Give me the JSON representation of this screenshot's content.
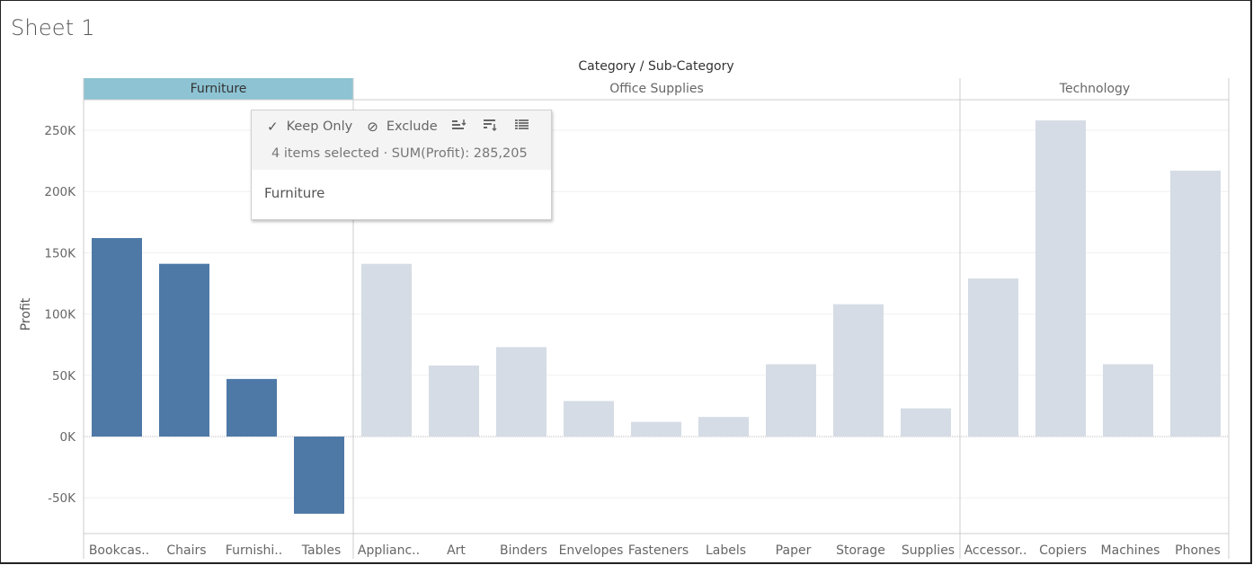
{
  "sheet": {
    "title": "Sheet 1"
  },
  "tooltip": {
    "keep_only_label": "Keep Only",
    "exclude_label": "Exclude",
    "summary": "4 items selected  ·  SUM(Profit): 285,205",
    "selection_label": "Furniture",
    "icons": [
      "check-icon",
      "exclude-icon",
      "sort-ascending-icon",
      "sort-descending-icon",
      "view-data-icon"
    ]
  },
  "colors": {
    "selected_bar": "#4e79a7",
    "unselected_bar": "#d5dce5",
    "selected_header": "#8dc3d3"
  },
  "chart_data": {
    "type": "bar",
    "title": "",
    "xlabel": "Category / Sub-Category",
    "ylabel": "Profit",
    "ylim": [
      -80000,
      275000
    ],
    "yticks": [
      -50000,
      0,
      50000,
      100000,
      150000,
      200000,
      250000
    ],
    "ytick_labels": [
      "-50K",
      "0K",
      "50K",
      "100K",
      "150K",
      "200K",
      "250K"
    ],
    "grid": true,
    "selected_category": "Furniture",
    "groups": [
      {
        "name": "Furniture",
        "selected": true,
        "categories": [
          "Bookcas..",
          "Chairs",
          "Furnishi..",
          "Tables"
        ],
        "values": [
          162000,
          141000,
          47000,
          -63000
        ]
      },
      {
        "name": "Office Supplies",
        "selected": false,
        "categories": [
          "Applianc..",
          "Art",
          "Binders",
          "Envelopes",
          "Fasteners",
          "Labels",
          "Paper",
          "Storage",
          "Supplies"
        ],
        "values": [
          141000,
          58000,
          73000,
          29000,
          12000,
          16000,
          59000,
          108000,
          23000
        ]
      },
      {
        "name": "Technology",
        "selected": false,
        "categories": [
          "Accessor..",
          "Copiers",
          "Machines",
          "Phones"
        ],
        "values": [
          129000,
          258000,
          59000,
          217000
        ]
      }
    ]
  }
}
